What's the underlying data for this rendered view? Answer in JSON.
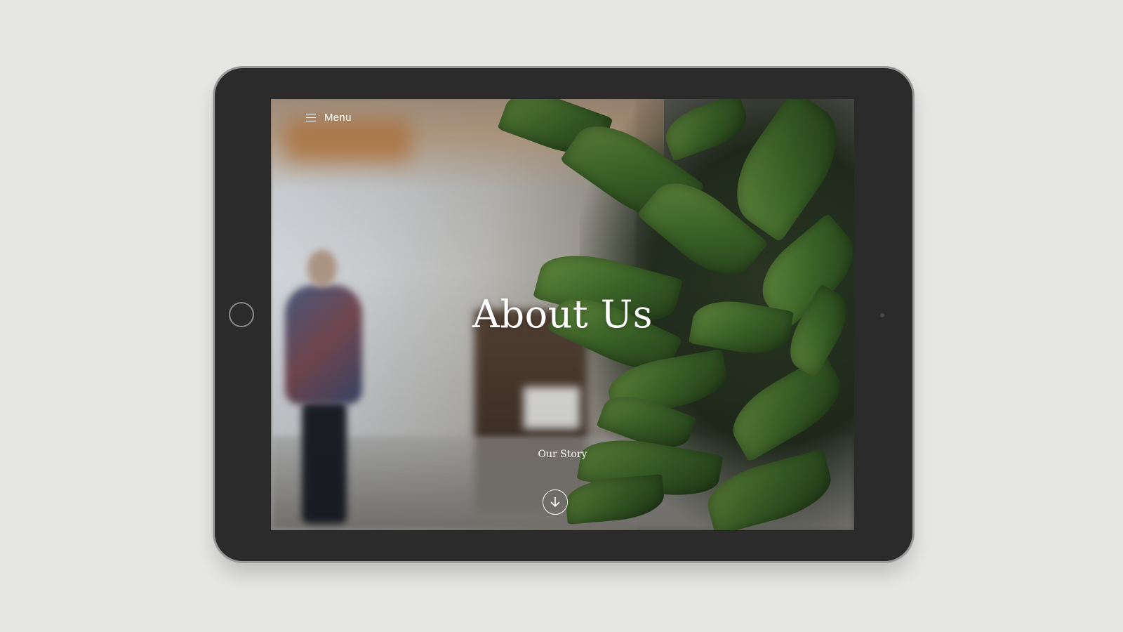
{
  "header": {
    "menu_label": "Menu",
    "menu_icon": "hamburger-icon"
  },
  "hero": {
    "title": "About Us",
    "subtitle": "Our Story",
    "scroll_icon": "arrow-down-circle-icon"
  },
  "colors": {
    "device_bezel": "#2b2b2b",
    "text": "#ffffff",
    "background": "#e7e7e6"
  }
}
